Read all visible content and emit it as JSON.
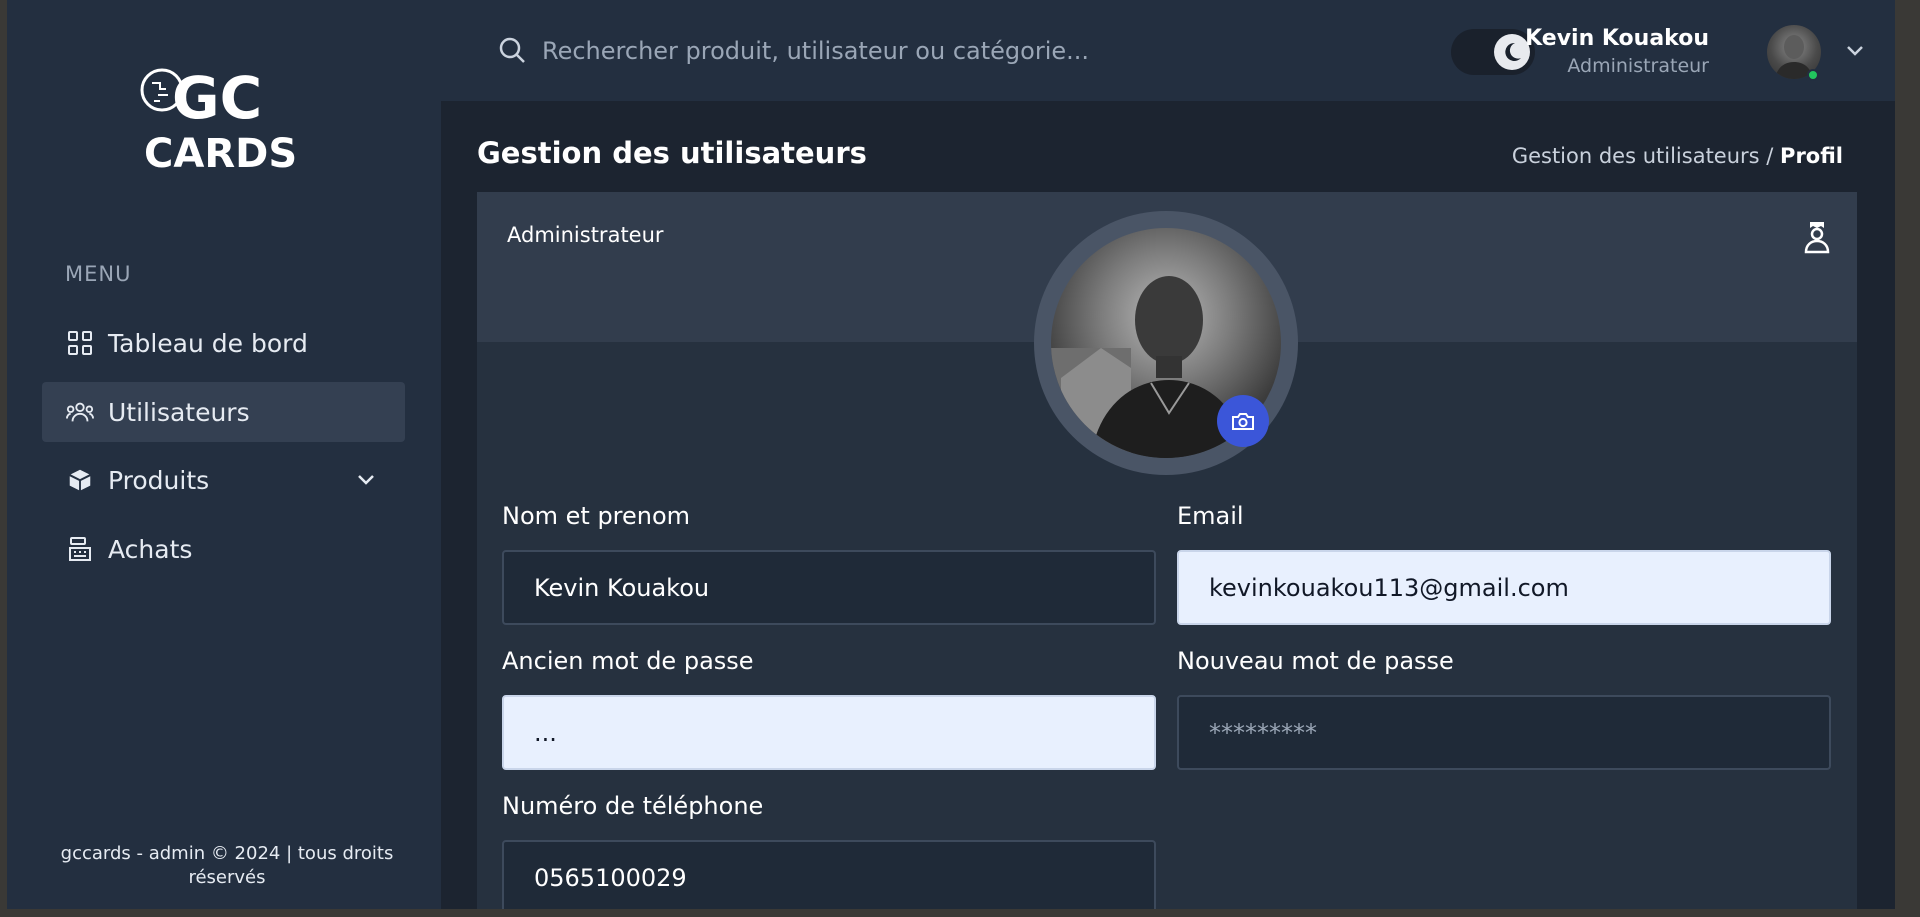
{
  "brand": {
    "logo_top": "GC",
    "logo_bottom": "CARDS"
  },
  "sidebar": {
    "menu_title": "MENU",
    "items": [
      {
        "label": "Tableau de bord",
        "icon": "grid-icon"
      },
      {
        "label": "Utilisateurs",
        "icon": "users-icon",
        "active": true
      },
      {
        "label": "Produits",
        "icon": "package-icon",
        "has_submenu": true
      },
      {
        "label": "Achats",
        "icon": "cash-register-icon"
      }
    ],
    "footer": "gccards - admin © 2024 | tous droits réservés"
  },
  "header": {
    "search_placeholder": "Rechercher produit, utilisateur ou catégorie...",
    "theme": "dark",
    "user": {
      "name": "Kevin Kouakou",
      "role": "Administrateur",
      "status": "online"
    }
  },
  "page": {
    "title": "Gestion des utilisateurs",
    "breadcrumb": {
      "parent": "Gestion des utilisateurs /",
      "current": "Profil"
    }
  },
  "profile": {
    "role_label": "Administrateur",
    "fields": {
      "name": {
        "label": "Nom et prenom",
        "value": "Kevin Kouakou"
      },
      "email": {
        "label": "Email",
        "value": "kevinkouakou113@gmail.com"
      },
      "old_password": {
        "label": "Ancien mot de passe",
        "value": "..."
      },
      "new_password": {
        "label": "Nouveau mot de passe",
        "placeholder": "*********"
      },
      "phone": {
        "label": "Numéro de téléphone",
        "value": "0565100029"
      }
    }
  },
  "colors": {
    "accent": "#3b56d9",
    "online": "#22c55e",
    "sidebar_bg": "#232f40",
    "main_bg": "#1c2430"
  }
}
